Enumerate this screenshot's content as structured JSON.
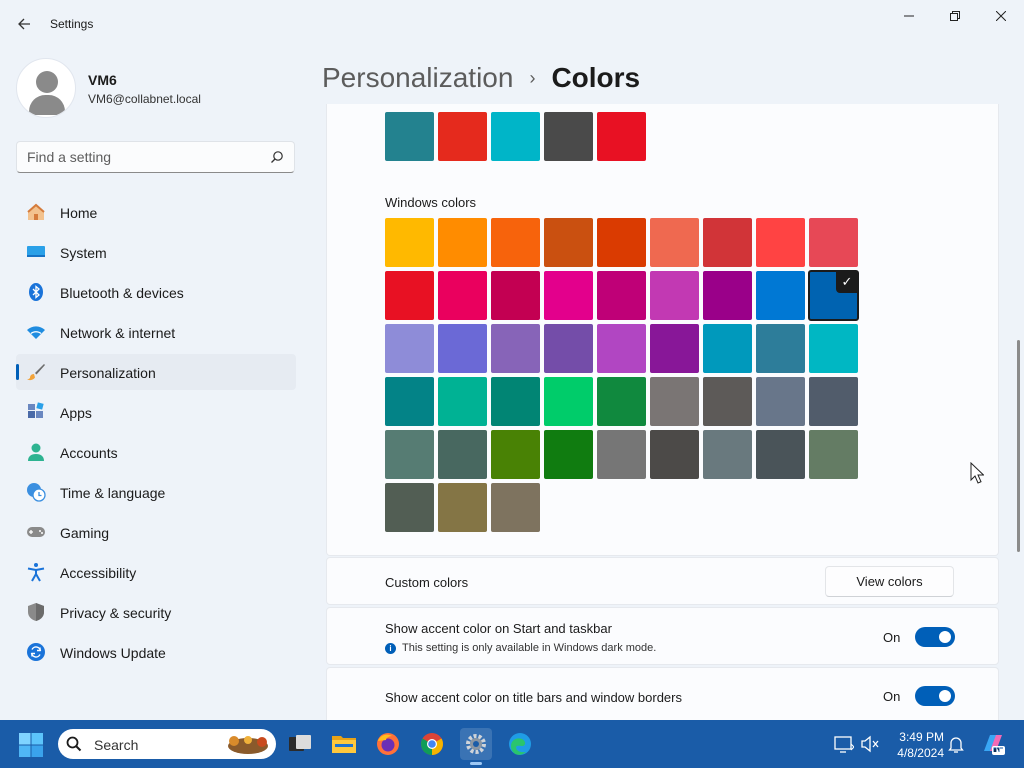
{
  "window": {
    "app_title": "Settings"
  },
  "profile": {
    "name": "VM6",
    "email": "VM6@collabnet.local"
  },
  "search": {
    "placeholder": "Find a setting"
  },
  "nav": {
    "items": [
      {
        "label": "Home",
        "icon": "home-icon"
      },
      {
        "label": "System",
        "icon": "system-icon"
      },
      {
        "label": "Bluetooth & devices",
        "icon": "bluetooth-icon"
      },
      {
        "label": "Network & internet",
        "icon": "wifi-icon"
      },
      {
        "label": "Personalization",
        "icon": "brush-icon",
        "selected": true
      },
      {
        "label": "Apps",
        "icon": "apps-icon"
      },
      {
        "label": "Accounts",
        "icon": "accounts-icon"
      },
      {
        "label": "Time & language",
        "icon": "clock-globe-icon"
      },
      {
        "label": "Gaming",
        "icon": "gamepad-icon"
      },
      {
        "label": "Accessibility",
        "icon": "accessibility-icon"
      },
      {
        "label": "Privacy & security",
        "icon": "shield-icon"
      },
      {
        "label": "Windows Update",
        "icon": "update-icon"
      }
    ]
  },
  "breadcrumb": {
    "parent": "Personalization",
    "separator": "›",
    "current": "Colors"
  },
  "recent_colors": [
    "#23828f",
    "#e52a1d",
    "#00b5c8",
    "#4a4a4a",
    "#e81123"
  ],
  "windows_colors": {
    "label": "Windows colors",
    "selected_index": 17,
    "swatches": [
      "#ffb900",
      "#ff8c00",
      "#f7630c",
      "#ca5010",
      "#da3b01",
      "#ef6950",
      "#d13438",
      "#ff4343",
      "#e74856",
      "#e81123",
      "#ea005e",
      "#c30052",
      "#e3008c",
      "#bf0077",
      "#c239b3",
      "#9a0089",
      "#0078d4",
      "#0063b1",
      "#8e8cd8",
      "#6b69d6",
      "#8764b8",
      "#744da9",
      "#b146c2",
      "#881798",
      "#0099bc",
      "#2d7d9a",
      "#00b7c3",
      "#038387",
      "#00b294",
      "#018574",
      "#00cc6a",
      "#10893e",
      "#7a7574",
      "#5d5a58",
      "#68768a",
      "#515c6b",
      "#567c73",
      "#486860",
      "#498205",
      "#107c10",
      "#767676",
      "#4c4a48",
      "#69797e",
      "#4a5459",
      "#647c64",
      "#525e54",
      "#847545",
      "#7e735f"
    ]
  },
  "custom_colors": {
    "label": "Custom colors",
    "button": "View colors"
  },
  "accent_start": {
    "label": "Show accent color on Start and taskbar",
    "hint": "This setting is only available in Windows dark mode.",
    "state": "On",
    "on": true
  },
  "accent_title": {
    "label": "Show accent color on title bars and window borders",
    "state": "On",
    "on": true
  },
  "taskbar": {
    "search_label": "Search",
    "time": "3:49 PM",
    "date": "4/8/2024"
  },
  "colors": {
    "accent": "#005fb8",
    "taskbar": "#1a5ca8"
  }
}
